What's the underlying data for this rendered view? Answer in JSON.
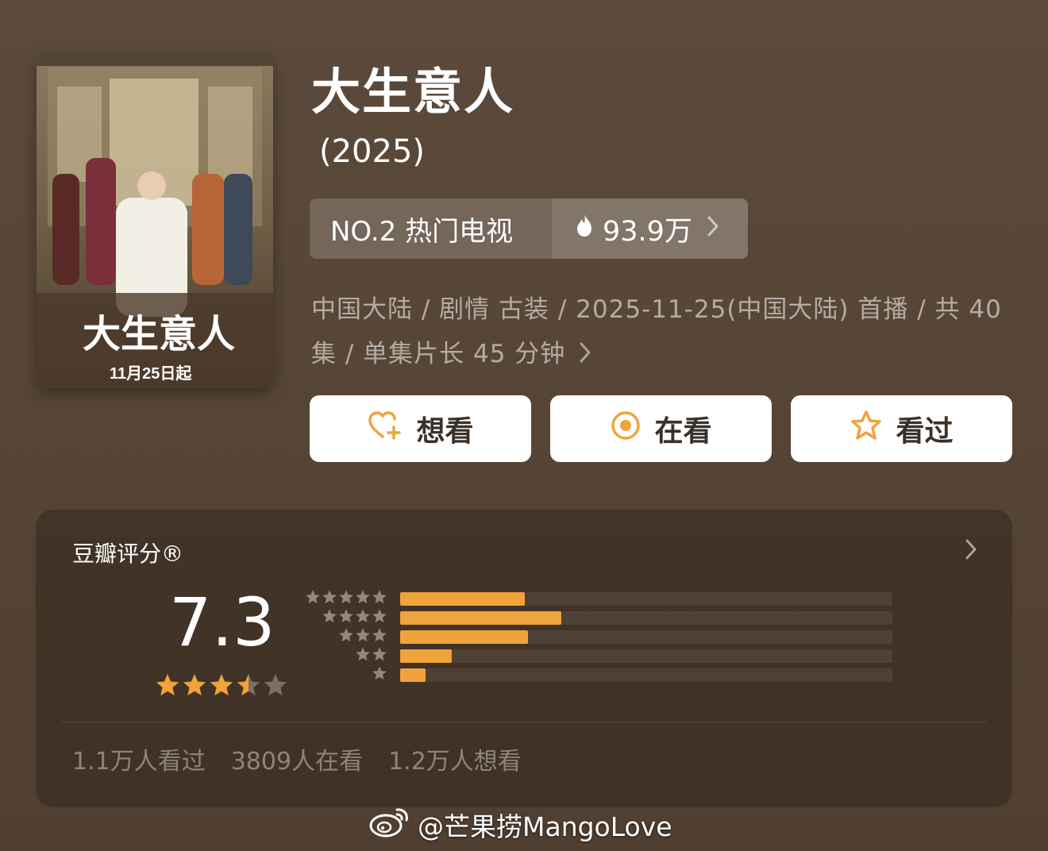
{
  "poster": {
    "title_art": "大生意人",
    "release_line": "11月25日起",
    "description": "poster"
  },
  "title": "大生意人",
  "year": "(2025)",
  "rank": {
    "label": "NO.2 热门电视",
    "heat": "93.9万"
  },
  "meta": {
    "line": "中国大陆 / 剧情 古装 / 2025-11-25(中国大陆) 首播 / 共 40 集 / 单集片长 45 分钟"
  },
  "actions": [
    {
      "label": "想看",
      "icon": "heart-plus-icon"
    },
    {
      "label": "在看",
      "icon": "target-icon"
    },
    {
      "label": "看过",
      "icon": "star-outline-icon"
    }
  ],
  "rating": {
    "label": "豆瓣评分®",
    "score": "7.3",
    "stars_filled": 3.5,
    "distribution": [
      {
        "stars": 5,
        "fraction": 0.254
      },
      {
        "stars": 4,
        "fraction": 0.327
      },
      {
        "stars": 3,
        "fraction": 0.26
      },
      {
        "stars": 2,
        "fraction": 0.105
      },
      {
        "stars": 1,
        "fraction": 0.052
      }
    ],
    "stats": {
      "watched": "1.1万人看过",
      "watching": "3809人在看",
      "wish": "1.2万人想看"
    }
  },
  "colors": {
    "accent": "#f0a33a",
    "background": "#574636"
  },
  "watermark": "@芒果捞MangoLove"
}
